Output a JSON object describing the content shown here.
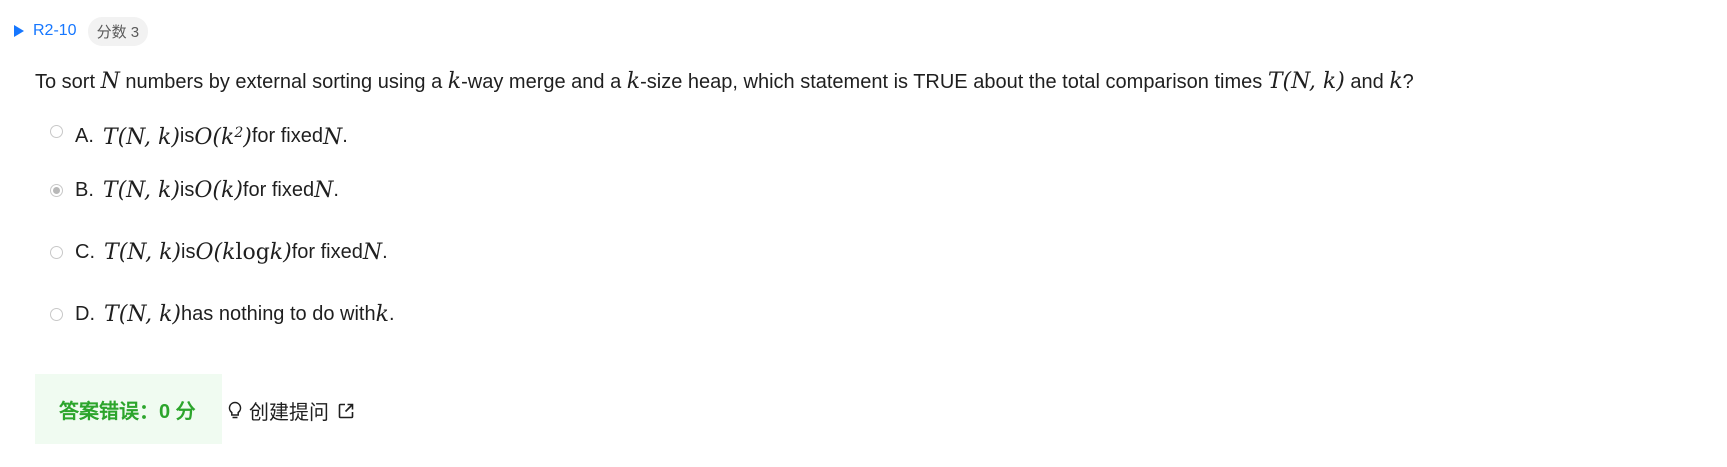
{
  "header": {
    "question_id": "R2-10",
    "score_tag": "分数 3"
  },
  "question": {
    "pre": "To sort ",
    "var_N": "N",
    "mid1": " numbers by external sorting using a ",
    "var_k1": "k",
    "mid2": "-way merge and a ",
    "var_k2": "k",
    "mid3": "-size heap, which statement is TRUE about the total comparison times ",
    "expr_T": "T",
    "expr_args": "(N, k)",
    "mid4": " and ",
    "var_k3": "k",
    "end": "?"
  },
  "options": [
    {
      "letter": "A.",
      "lhs_T": "T",
      "lhs_args": "(N, k)",
      "text1": " is ",
      "rhs_pre": "O(k",
      "rhs_sup": "2",
      "rhs_post": ")",
      "text2": " for fixed ",
      "var": "N",
      "end": ".",
      "selected": false
    },
    {
      "letter": "B.",
      "lhs_T": "T",
      "lhs_args": "(N, k)",
      "text1": " is ",
      "rhs": "O(k)",
      "text2": " for fixed ",
      "var": "N",
      "end": ".",
      "selected": true
    },
    {
      "letter": "C.",
      "lhs_T": "T",
      "lhs_args": "(N, k)",
      "text1": " is ",
      "rhs_pre": "O(k ",
      "rhs_log": "log",
      "rhs_post": " k)",
      "text2": " for fixed ",
      "var": "N",
      "end": ".",
      "selected": false
    },
    {
      "letter": "D.",
      "lhs_T": "T",
      "lhs_args": "(N, k)",
      "text1": " has nothing to do with ",
      "var": "k",
      "end": ".",
      "selected": false
    }
  ],
  "result": {
    "text": "答案错误：0 分"
  },
  "actions": {
    "create_question_label": "创建提问",
    "bulb_icon": "lightbulb-icon",
    "external_icon": "external-link-icon"
  },
  "colors": {
    "accent": "#1677ff",
    "success": "#2ca52c",
    "success_bg": "#f0fbf1"
  }
}
